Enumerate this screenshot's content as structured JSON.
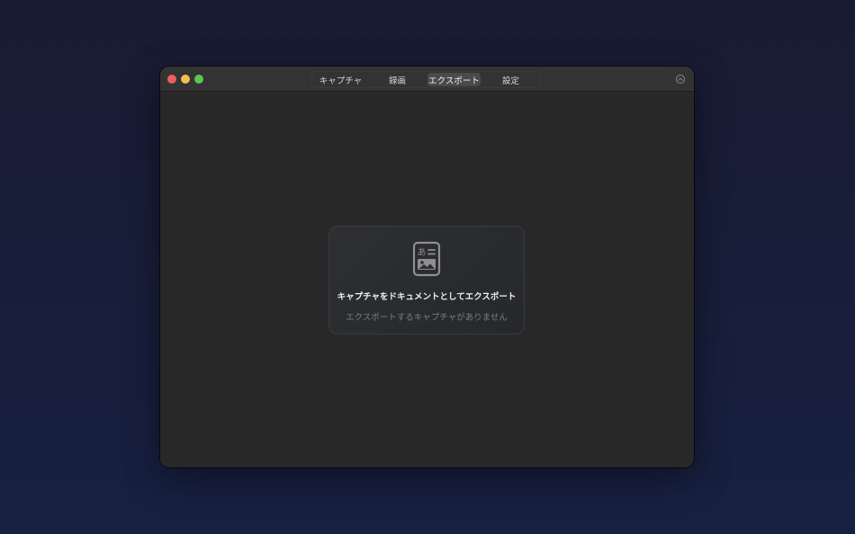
{
  "window": {
    "traffic_lights": {
      "close_color": "#ec5f59",
      "minimize_color": "#f4bd4f",
      "zoom_color": "#5fc454"
    }
  },
  "toolbar": {
    "tabs": [
      {
        "label": "キャプチャ",
        "selected": false
      },
      {
        "label": "録画",
        "selected": false
      },
      {
        "label": "エクスポート",
        "selected": true
      },
      {
        "label": "設定",
        "selected": false
      }
    ],
    "corner_icon": "chevron-up-circle-icon"
  },
  "export_panel": {
    "icon": "document-text-image-icon",
    "icon_glyph": "あ",
    "title": "キャプチャをドキュメントとしてエクスポート",
    "message": "エクスポートするキャプチャがありません"
  }
}
